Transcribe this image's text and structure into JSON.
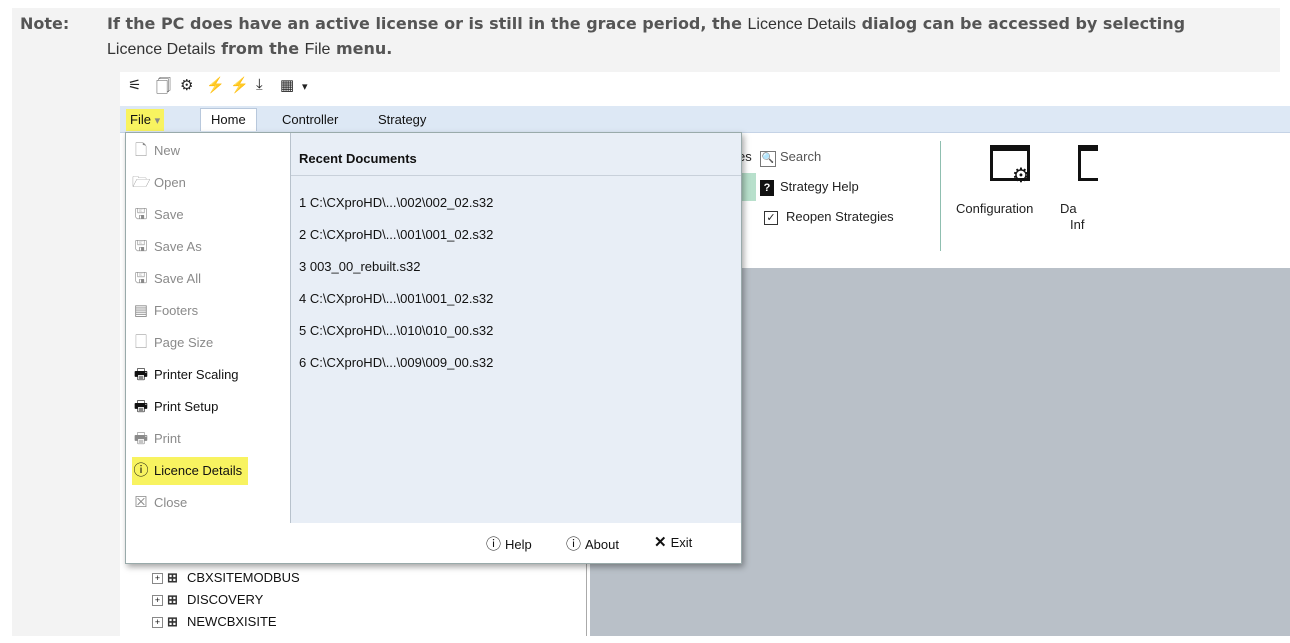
{
  "note": {
    "label": "Note:",
    "text_part1": "If the PC does have an active license or is still in the grace period, the ",
    "ui_term1": "Licence Details",
    "text_part2": " dialog can be accessed by selecting ",
    "ui_term2": "Licence Details",
    "text_part3": " from the ",
    "ui_term3": "File",
    "text_part4": " menu."
  },
  "ribbon": {
    "tabs": [
      "File",
      "Home",
      "Controller",
      "Strategy"
    ],
    "file_dropdown_glyph": "▾",
    "items": {
      "search": "Search",
      "strategy_help": "Strategy Help",
      "reopen_strategies": "Reopen Strategies",
      "configuration": "Configuration",
      "partial_da": "Da",
      "partial_inf": "Inf",
      "partial_es": "es"
    }
  },
  "file_menu": {
    "items": [
      {
        "label": "New",
        "icon": "new-file-icon",
        "glyph": "🗋",
        "enabled": false,
        "highlight": false
      },
      {
        "label": "Open",
        "icon": "open-folder-icon",
        "glyph": "🗁",
        "enabled": false,
        "highlight": false
      },
      {
        "label": "Save",
        "icon": "save-icon",
        "glyph": "🖫",
        "enabled": false,
        "highlight": false
      },
      {
        "label": "Save As",
        "icon": "save-as-icon",
        "glyph": "🖫",
        "enabled": false,
        "highlight": false
      },
      {
        "label": "Save All",
        "icon": "save-all-icon",
        "glyph": "🖫",
        "enabled": false,
        "highlight": false
      },
      {
        "label": "Footers",
        "icon": "footers-icon",
        "glyph": "▤",
        "enabled": false,
        "highlight": false
      },
      {
        "label": "Page Size",
        "icon": "page-size-icon",
        "glyph": "🗌",
        "enabled": false,
        "highlight": false
      },
      {
        "label": "Printer Scaling",
        "icon": "printer-scaling-icon",
        "glyph": "🖶",
        "enabled": true,
        "highlight": false
      },
      {
        "label": "Print Setup",
        "icon": "print-setup-icon",
        "glyph": "🖶",
        "enabled": true,
        "highlight": false
      },
      {
        "label": "Print",
        "icon": "print-icon",
        "glyph": "🖶",
        "enabled": false,
        "highlight": false
      },
      {
        "label": "Licence Details",
        "icon": "info-circle-icon",
        "glyph": "ⓘ",
        "enabled": true,
        "highlight": true
      },
      {
        "label": "Close",
        "icon": "close-icon",
        "glyph": "☒",
        "enabled": false,
        "highlight": false
      }
    ],
    "recent_header": "Recent Documents",
    "recent": [
      "1 C:\\CXproHD\\...\\002\\002_02.s32",
      "2 C:\\CXproHD\\...\\001\\001_02.s32",
      "3 003_00_rebuilt.s32",
      "4 C:\\CXproHD\\...\\001\\001_02.s32",
      "5 C:\\CXproHD\\...\\010\\010_00.s32",
      "6 C:\\CXproHD\\...\\009\\009_00.s32"
    ],
    "footer": {
      "help": "Help",
      "about": "About",
      "exit": "Exit"
    }
  },
  "tree": {
    "items": [
      "CBXSITEMODBUS",
      "DISCOVERY",
      "NEWCBXISITE"
    ]
  },
  "colors": {
    "highlight": "#f8f360",
    "ribbon_tabs": "#dde8f5",
    "workspace": "#b9c0c8",
    "recent_bg": "#e8eef6"
  }
}
